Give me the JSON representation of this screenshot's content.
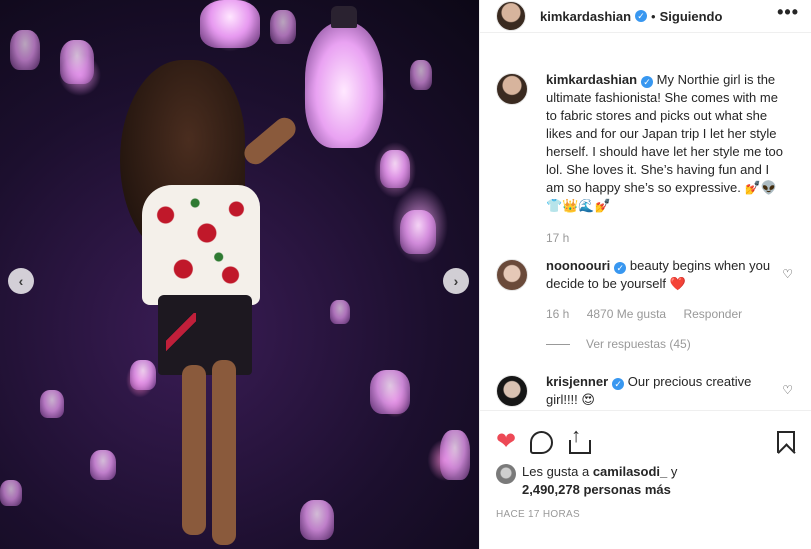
{
  "header": {
    "username": "kimkardashian",
    "separator": "•",
    "follow_status": "Siguiendo",
    "more": "•••"
  },
  "photo": {
    "prev_arrow": "‹",
    "next_arrow": "›"
  },
  "caption": {
    "username": "kimkardashian",
    "text": "My Northie girl is the ultimate fashionista! She comes with me to fabric stores and picks out what she likes and for our Japan trip I let her style herself. I should have let her style me too lol. She loves it. She’s having fun and I am so happy she’s so expressive. 💅👽👕👑🌊💅",
    "time": "17 h"
  },
  "comments": [
    {
      "username": "noonoouri",
      "text": "beauty begins when you decide to be yourself ❤️",
      "time": "16 h",
      "likes": "4870 Me gusta",
      "reply": "Responder",
      "view_replies": "Ver respuestas (45)"
    },
    {
      "username": "krisjenner",
      "text": "Our precious creative girl!!!! 😍"
    }
  ],
  "icons": {
    "verified": "✓",
    "heart_small": "♡",
    "heart_filled": "❤"
  },
  "likes": {
    "prefix": "Les gusta a ",
    "user": "camilasodi_",
    "middle": " y",
    "count": "2,490,278 personas más"
  },
  "timestamp": "HACE 17 HORAS",
  "colors": {
    "verified": "#3897f0",
    "like": "#ed4956",
    "muted": "#999999"
  }
}
